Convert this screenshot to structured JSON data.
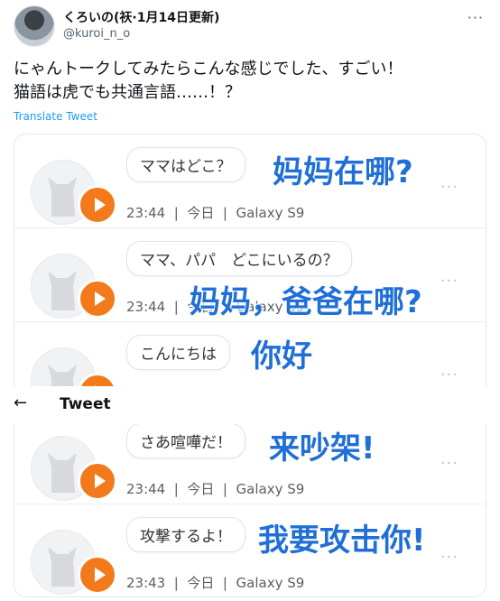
{
  "author": {
    "display_name": "くろいの(祆·1月14日更新)",
    "handle": "@kuroi_n_o"
  },
  "tweet": {
    "text": "にゃんトークしてみたらこんな感じでした、すごい！\n猫語は虎でも共通言語……！？",
    "translate_label": "Translate Tweet"
  },
  "overlay_bar": {
    "back_icon": "←",
    "title": "Tweet"
  },
  "messages": [
    {
      "bubble": "ママはどこ？",
      "time": "23:44",
      "day": "今日",
      "device": "Galaxy S9",
      "caption": "妈妈在哪?"
    },
    {
      "bubble": "ママ、パパ　どこにいるの？",
      "time": "23:44",
      "day": "今日",
      "device": "Galaxy S9",
      "caption": "妈妈，爸爸在哪?"
    },
    {
      "bubble": "こんにちは",
      "time": "",
      "day": "",
      "device": "",
      "caption": "你好"
    },
    {
      "bubble": "さあ喧嘩だ！",
      "time": "23:44",
      "day": "今日",
      "device": "Galaxy S9",
      "caption": "来吵架!"
    },
    {
      "bubble": "攻撃するよ！",
      "time": "23:43",
      "day": "今日",
      "device": "Galaxy S9",
      "caption": "我要攻击你!"
    }
  ],
  "icons": {
    "more": "more-horizontal-icon",
    "play": "play-icon",
    "back": "arrow-left-icon",
    "cat": "cat-avatar-icon"
  },
  "colors": {
    "accent": "#1d9bf0",
    "play": "#f37a1a",
    "caption": "#1f6fd6"
  }
}
